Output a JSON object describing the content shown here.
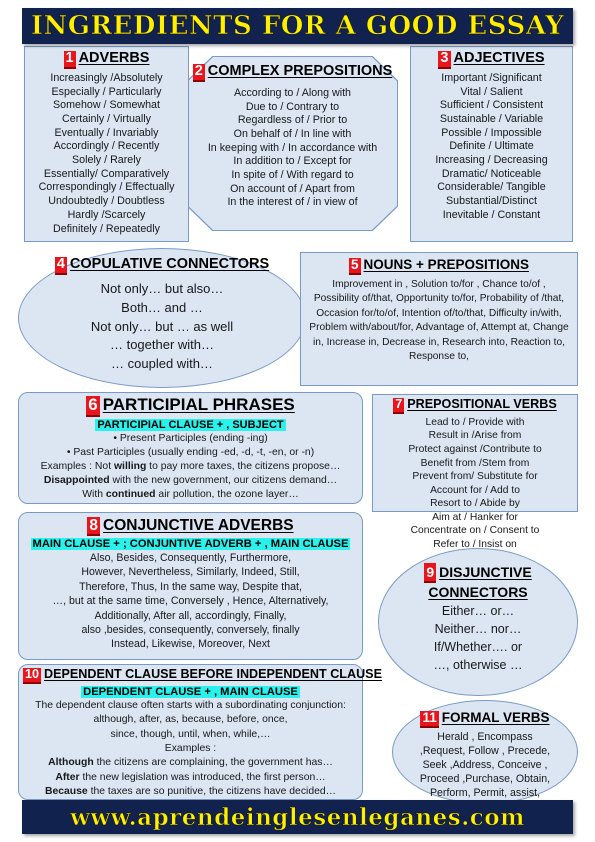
{
  "title_banner": {
    "text": "INGREDIENTS FOR A GOOD ESSAY"
  },
  "footer_banner": {
    "text": "www.aprendeinglesenleganes.com"
  },
  "colors": {
    "banner_bg": "#11224f",
    "banner_text": "#ffef00",
    "box_fill": "#dce6f2",
    "box_border": "#7a9ac4",
    "number_badge_bg": "#e8161c",
    "highlight": "#29f1ec"
  },
  "sections": {
    "adverbs": {
      "number": "1",
      "title": "ADVERBS",
      "lines": [
        "Increasingly /Absolutely",
        "Especially / Particularly",
        "Somehow / Somewhat",
        "Certainly / Virtually",
        "Eventually / Invariably",
        "Accordingly / Recently",
        "Solely / Rarely",
        "Essentially/ Comparatively",
        "Correspondingly / Effectually",
        "Undoubtedly / Doubtless",
        "Hardly /Scarcely",
        "Definitely / Repeatedly"
      ]
    },
    "complex_prepositions": {
      "number": "2",
      "title": "COMPLEX PREPOSITIONS",
      "lines": [
        "According to / Along with",
        "Due to / Contrary to",
        "Regardless of / Prior to",
        "On behalf of / In line with",
        "In keeping with / In accordance with",
        "In addition to / Except for",
        "In spite of / With regard to",
        "On account of / Apart from",
        "In the interest of / in view of"
      ]
    },
    "adjectives": {
      "number": "3",
      "title": "ADJECTIVES",
      "lines": [
        "Important /Significant",
        "Vital / Salient",
        "Sufficient / Consistent",
        "Sustainable / Variable",
        "Possible / Impossible",
        "Definite / Ultimate",
        "Increasing / Decreasing",
        "Dramatic/ Noticeable",
        "Considerable/ Tangible",
        "Substantial/Distinct",
        "Inevitable / Constant"
      ]
    },
    "copulative_connectors": {
      "number": "4",
      "title": "COPULATIVE CONNECTORS",
      "lines": [
        "Not only…    but also…",
        "Both…    and …",
        "Not only…  but … as well",
        "… together with…",
        "… coupled with…"
      ]
    },
    "nouns_prepositions": {
      "number": "5",
      "title": "NOUNS + PREPOSITIONS",
      "body": "Improvement in ,  Solution to/for , Chance to/of , Possibility of/that, Opportunity to/for, Probability of /that, Occasion for/to/of, Intention of/to/that, Difficulty in/with, Problem with/about/for, Advantage of, Attempt at, Change in, Increase in, Decrease in, Research into, Reaction to, Response to,"
    },
    "participial_phrases": {
      "number": "6",
      "title": "PARTICIPIAL PHRASES",
      "highlight": "PARTICIPIAL CLAUSE + , SUBJECT",
      "bullet_present": "• Present Participles (ending -ing)",
      "bullet_past": "• Past Participles (usually ending -ed, -d, -t, -en, or -n)",
      "example_1_pre": "Examples : Not ",
      "example_1_bold": "willing",
      "example_1_post": " to pay more taxes, the citizens propose…",
      "example_2_bold": "Disappointed",
      "example_2_post": " with the new government, our citizens demand…",
      "example_3_pre": "With ",
      "example_3_bold": "continued",
      "example_3_post": " air pollution, the ozone layer…"
    },
    "prepositional_verbs": {
      "number": "7",
      "title": "PREPOSITIONAL VERBS",
      "lines": [
        "Lead to / Provide with",
        "Result in /Arise from",
        "Protect against /Contribute to",
        "Benefit from /Stem from",
        "Prevent from/ Substitute for",
        "Account for / Add to",
        "Resort to / Abide by",
        "Aim at / Hanker for",
        "Concentrate on / Consent to",
        "Refer to / Insist on"
      ]
    },
    "conjunctive_adverbs": {
      "number": "8",
      "title": "CONJUNCTIVE ADVERBS",
      "highlight": "MAIN CLAUSE + ; CONJUNTIVE ADVERB + , MAIN CLAUSE",
      "lines": [
        "Also, Besides, Consequently, Furthermore,",
        "However, Nevertheless, Similarly, Indeed, Still,",
        "Therefore, Thus, In the same way, Despite that,",
        "…, but at the same time, Conversely , Hence, Alternatively,",
        "Additionally, After all, accordingly, Finally,",
        "also ,besides, consequently, conversely, finally",
        "Instead, Likewise, Moreover, Next"
      ]
    },
    "disjunctive_connectors": {
      "number": "9",
      "title": "DISJUNCTIVE",
      "title_line2": "CONNECTORS",
      "lines": [
        "Either… or…",
        "Neither… nor…",
        "If/Whether…. or",
        "…, otherwise …"
      ]
    },
    "dependent_clause": {
      "number": "10",
      "title": "DEPENDENT CLAUSE BEFORE INDEPENDENT CLAUSE",
      "highlight": "DEPENDENT CLAUSE + , MAIN CLAUSE",
      "intro": "The dependent clause often starts with a subordinating conjunction:",
      "conj_line_1": "although, after, as, because, before, once,",
      "conj_line_2": "since, though, until, when, while,…",
      "examples_label": "Examples :",
      "example_1_bold": "Although",
      "example_1_post": " the citizens are complaining, the government has…",
      "example_2_bold": "After",
      "example_2_post": " the new legislation was introduced, the first person…",
      "example_3_bold": "Because",
      "example_3_post": " the taxes are so punitive, the citizens have decided…"
    },
    "formal_verbs": {
      "number": "11",
      "title": "FORMAL VERBS",
      "lines": [
        "Herald , Encompass",
        ",Request, Follow , Precede,",
        "Seek ,Address, Conceive ,",
        "Proceed ,Purchase, Obtain,",
        "Perform, Permit, assist,"
      ]
    }
  }
}
